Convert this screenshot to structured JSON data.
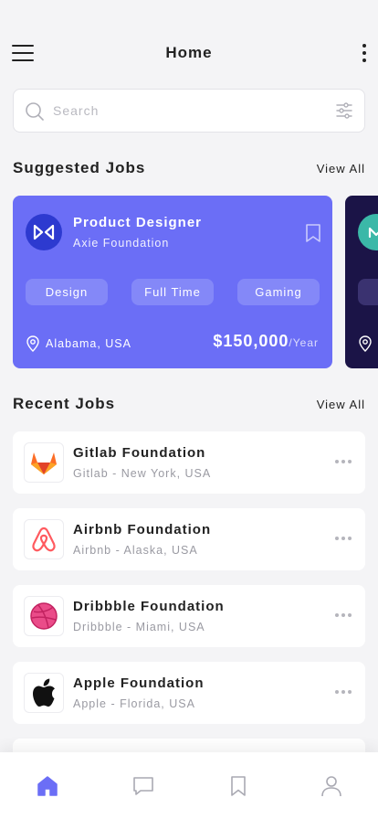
{
  "header": {
    "title": "Home"
  },
  "search": {
    "placeholder": "Search"
  },
  "suggested": {
    "title": "Suggested Jobs",
    "view_all": "View All",
    "cards": [
      {
        "title": "Product Designer",
        "company": "Axie Foundation",
        "tags": [
          "Design",
          "Full Time",
          "Gaming"
        ],
        "location": "Alabama, USA",
        "salary": "$150,000",
        "period": "/Year",
        "color": "#6b6ef6",
        "logo_icon": "axie-logo-icon"
      },
      {
        "color": "#1b1447",
        "logo_icon": "partial-logo-icon"
      }
    ]
  },
  "recent": {
    "title": "Recent Jobs",
    "view_all": "View All",
    "items": [
      {
        "name": "Gitlab Foundation",
        "sub": "Gitlab - New York, USA",
        "logo_icon": "gitlab-logo-icon"
      },
      {
        "name": "Airbnb Foundation",
        "sub": "Airbnb - Alaska, USA",
        "logo_icon": "airbnb-logo-icon"
      },
      {
        "name": "Dribbble Foundation",
        "sub": "Dribbble - Miami, USA",
        "logo_icon": "dribbble-logo-icon"
      },
      {
        "name": "Apple Foundation",
        "sub": "Apple - Florida, USA",
        "logo_icon": "apple-logo-icon"
      }
    ]
  },
  "bottom_nav": {
    "items": [
      "home-icon",
      "chat-icon",
      "bookmark-icon",
      "profile-icon"
    ],
    "active": "home-icon",
    "active_color": "#6b6ef6",
    "inactive_color": "#a9a9b2"
  }
}
